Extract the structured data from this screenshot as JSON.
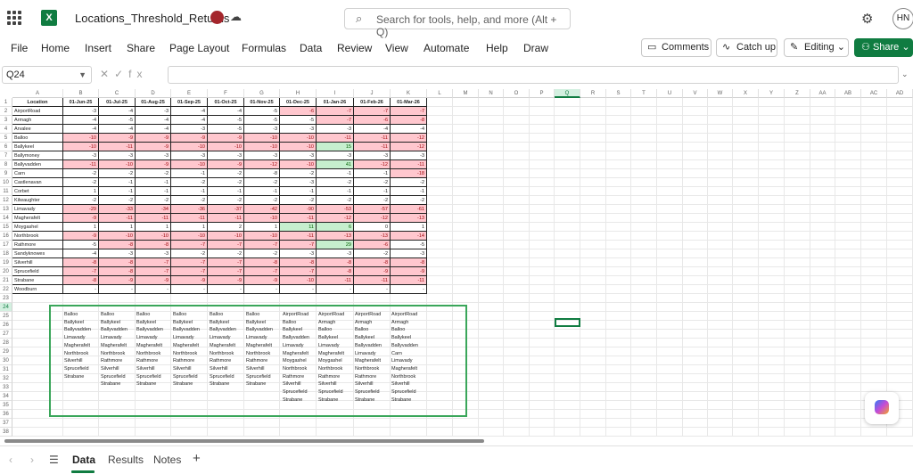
{
  "app": {
    "title": "Locations_Threshold_Returns",
    "logo": "X"
  },
  "search": {
    "placeholder": "Search for tools, help, and more (Alt + Q)"
  },
  "user": {
    "initials": "HN"
  },
  "menu": [
    "File",
    "Home",
    "Insert",
    "Share",
    "Page Layout",
    "Formulas",
    "Data",
    "Review",
    "View",
    "Automate",
    "Help",
    "Draw"
  ],
  "toolbar": {
    "comments": "Comments",
    "catchup": "Catch up",
    "editing": "Editing",
    "share": "Share"
  },
  "namebox": {
    "value": "Q24"
  },
  "columns": [
    "A",
    "B",
    "C",
    "D",
    "E",
    "F",
    "G",
    "H",
    "I",
    "J",
    "K",
    "L",
    "M",
    "N",
    "O",
    "P",
    "Q",
    "R",
    "S",
    "T",
    "U",
    "V",
    "W",
    "X",
    "Y",
    "Z",
    "AA",
    "AB",
    "AC",
    "AD"
  ],
  "selected_column": "Q",
  "selected_row": 24,
  "rows": [
    "1",
    "2",
    "3",
    "4",
    "5",
    "6",
    "7",
    "8",
    "9",
    "10",
    "11",
    "12",
    "13",
    "14",
    "15",
    "16",
    "17",
    "18",
    "19",
    "20",
    "21",
    "22",
    "23",
    "24",
    "25",
    "26",
    "27",
    "28",
    "29",
    "30",
    "31",
    "32",
    "33",
    "34",
    "35",
    "36",
    "37",
    "38"
  ],
  "header": [
    "Location",
    "01-Jun-25",
    "01-Jul-25",
    "01-Aug-25",
    "01-Sep-25",
    "01-Oct-25",
    "01-Nov-25",
    "01-Dec-25",
    "01-Jan-26",
    "01-Feb-26",
    "01-Mar-26"
  ],
  "data": [
    {
      "loc": "AirportRoad",
      "v": [
        "-3",
        "-4",
        "-3",
        "-4",
        "-4",
        "-5",
        "-6",
        "-7",
        "-7",
        "-7"
      ],
      "c": [
        "",
        "",
        "",
        "",
        "",
        "",
        "r",
        "r",
        "r",
        "r"
      ]
    },
    {
      "loc": "Armagh",
      "v": [
        "-4",
        "-5",
        "-4",
        "-4",
        "-5",
        "-5",
        "-5",
        "-7",
        "-6",
        "-8"
      ],
      "c": [
        "",
        "",
        "",
        "",
        "",
        "",
        "",
        "r",
        "r",
        "r"
      ]
    },
    {
      "loc": "Arvalee",
      "v": [
        "-4",
        "-4",
        "-4",
        "-3",
        "-5",
        "-3",
        "-3",
        "-3",
        "-4",
        "-4"
      ],
      "c": [
        "",
        "",
        "",
        "",
        "",
        "",
        "",
        "",
        "",
        ""
      ]
    },
    {
      "loc": "Balloo",
      "v": [
        "-10",
        "-9",
        "-9",
        "-9",
        "-9",
        "-10",
        "-10",
        "-11",
        "-11",
        "-12"
      ],
      "c": [
        "r",
        "r",
        "r",
        "r",
        "r",
        "r",
        "r",
        "r",
        "r",
        "r"
      ]
    },
    {
      "loc": "Ballykeel",
      "v": [
        "-10",
        "-11",
        "-9",
        "-10",
        "-10",
        "-10",
        "-10",
        "15",
        "-11",
        "-12"
      ],
      "c": [
        "r",
        "r",
        "r",
        "r",
        "r",
        "r",
        "r",
        "g",
        "r",
        "r"
      ]
    },
    {
      "loc": "Ballymoney",
      "v": [
        "-3",
        "-3",
        "-3",
        "-3",
        "-3",
        "-3",
        "-3",
        "-3",
        "-3",
        "-3"
      ],
      "c": [
        "",
        "",
        "",
        "",
        "",
        "",
        "",
        "",
        "",
        ""
      ]
    },
    {
      "loc": "Ballyvadden",
      "v": [
        "-11",
        "-10",
        "-9",
        "-10",
        "-9",
        "-12",
        "-10",
        "41",
        "-12",
        "-11"
      ],
      "c": [
        "r",
        "r",
        "r",
        "r",
        "r",
        "r",
        "r",
        "g",
        "r",
        "r"
      ]
    },
    {
      "loc": "Carn",
      "v": [
        "-2",
        "-2",
        "-2",
        "-1",
        "-2",
        "-8",
        "-2",
        "-1",
        "-1",
        "-18"
      ],
      "c": [
        "",
        "",
        "",
        "",
        "",
        "",
        "",
        "",
        "",
        "r"
      ]
    },
    {
      "loc": "Castlenavan",
      "v": [
        "-2",
        "-1",
        "-1",
        "-2",
        "-2",
        "-2",
        "-3",
        "-2",
        "-2",
        "-2"
      ],
      "c": [
        "",
        "",
        "",
        "",
        "",
        "",
        "",
        "",
        "",
        ""
      ]
    },
    {
      "loc": "Corbet",
      "v": [
        "1",
        "-1",
        "-1",
        "-1",
        "-1",
        "-1",
        "-1",
        "-1",
        "-1",
        "-1"
      ],
      "c": [
        "",
        "",
        "",
        "",
        "",
        "",
        "",
        "",
        "",
        ""
      ]
    },
    {
      "loc": "Kilwaughter",
      "v": [
        "-2",
        "-2",
        "-2",
        "-2",
        "-2",
        "-2",
        "-2",
        "-2",
        "-2",
        "-2"
      ],
      "c": [
        "",
        "",
        "",
        "",
        "",
        "",
        "",
        "",
        "",
        ""
      ]
    },
    {
      "loc": "Limavady",
      "v": [
        "-29",
        "-33",
        "-34",
        "-36",
        "-37",
        "-42",
        "-90",
        "-53",
        "-57",
        "-61"
      ],
      "c": [
        "r",
        "r",
        "r",
        "r",
        "r",
        "r",
        "r",
        "r",
        "r",
        "r"
      ]
    },
    {
      "loc": "Magherafelt",
      "v": [
        "-9",
        "-11",
        "-11",
        "-11",
        "-11",
        "-10",
        "-11",
        "-12",
        "-12",
        "-13"
      ],
      "c": [
        "r",
        "r",
        "r",
        "r",
        "r",
        "r",
        "r",
        "r",
        "r",
        "r"
      ]
    },
    {
      "loc": "Moygashel",
      "v": [
        "1",
        "1",
        "1",
        "1",
        "2",
        "1",
        "11",
        "6",
        "0",
        "1"
      ],
      "c": [
        "",
        "",
        "",
        "",
        "",
        "",
        "g",
        "g",
        "",
        ""
      ]
    },
    {
      "loc": "Northbrook",
      "v": [
        "-9",
        "-10",
        "-10",
        "-10",
        "-10",
        "-10",
        "-11",
        "-13",
        "-13",
        "-14"
      ],
      "c": [
        "r",
        "r",
        "r",
        "r",
        "r",
        "r",
        "r",
        "r",
        "r",
        "r"
      ]
    },
    {
      "loc": "Rathmore",
      "v": [
        "-5",
        "-8",
        "-8",
        "-7",
        "-7",
        "-7",
        "-7",
        "29",
        "-6",
        "-5"
      ],
      "c": [
        "",
        "r",
        "r",
        "r",
        "r",
        "r",
        "r",
        "g",
        "r",
        ""
      ]
    },
    {
      "loc": "Sandyknowes",
      "v": [
        "-4",
        "-3",
        "-3",
        "-2",
        "-2",
        "-2",
        "-3",
        "-3",
        "-2",
        "-3"
      ],
      "c": [
        "",
        "",
        "",
        "",
        "",
        "",
        "",
        "",
        "",
        ""
      ]
    },
    {
      "loc": "Silverhill",
      "v": [
        "-8",
        "-8",
        "-7",
        "-7",
        "-7",
        "-8",
        "-8",
        "-8",
        "-8",
        "-8"
      ],
      "c": [
        "r",
        "r",
        "r",
        "r",
        "r",
        "r",
        "r",
        "r",
        "r",
        "r"
      ]
    },
    {
      "loc": "Sprucefield",
      "v": [
        "-7",
        "-8",
        "-7",
        "-7",
        "-7",
        "-7",
        "-7",
        "-8",
        "-9",
        "-9"
      ],
      "c": [
        "r",
        "r",
        "r",
        "r",
        "r",
        "r",
        "r",
        "r",
        "r",
        "r"
      ]
    },
    {
      "loc": "Strabane",
      "v": [
        "-8",
        "-9",
        "-9",
        "-9",
        "-9",
        "-9",
        "-10",
        "-11",
        "-11",
        "-11"
      ],
      "c": [
        "r",
        "r",
        "r",
        "r",
        "r",
        "r",
        "r",
        "r",
        "r",
        "r"
      ]
    },
    {
      "loc": "Woodburn",
      "v": [
        "-",
        "-",
        "-",
        "-",
        "-",
        "-",
        "-",
        "-",
        "-",
        "-"
      ],
      "c": [
        "",
        "",
        "",
        "",
        "",
        "",
        "",
        "",
        "",
        ""
      ]
    }
  ],
  "lists": [
    [
      "Balloo",
      "Ballykeel",
      "Ballyvadden",
      "Limavady",
      "Magherafelt",
      "Northbrook",
      "Silverhill",
      "Sprucefield",
      "Strabane"
    ],
    [
      "Balloo",
      "Ballykeel",
      "Ballyvadden",
      "Limavady",
      "Magherafelt",
      "Northbrook",
      "Rathmore",
      "Silverhill",
      "Sprucefield",
      "Strabane"
    ],
    [
      "Balloo",
      "Ballykeel",
      "Ballyvadden",
      "Limavady",
      "Magherafelt",
      "Northbrook",
      "Rathmore",
      "Silverhill",
      "Sprucefield",
      "Strabane"
    ],
    [
      "Balloo",
      "Ballykeel",
      "Ballyvadden",
      "Limavady",
      "Magherafelt",
      "Northbrook",
      "Rathmore",
      "Silverhill",
      "Sprucefield",
      "Strabane"
    ],
    [
      "Balloo",
      "Ballykeel",
      "Ballyvadden",
      "Limavady",
      "Magherafelt",
      "Northbrook",
      "Rathmore",
      "Silverhill",
      "Sprucefield",
      "Strabane"
    ],
    [
      "Balloo",
      "Ballykeel",
      "Ballyvadden",
      "Limavady",
      "Magherafelt",
      "Northbrook",
      "Rathmore",
      "Silverhill",
      "Sprucefield",
      "Strabane"
    ],
    [
      "AirportRoad",
      "Balloo",
      "Ballykeel",
      "Ballyvadden",
      "Limavady",
      "Magherafelt",
      "Moygashel",
      "Northbrook",
      "Rathmore",
      "Silverhill",
      "Sprucefield",
      "Strabane"
    ],
    [
      "AirportRoad",
      "Armagh",
      "Balloo",
      "Ballykeel",
      "Limavady",
      "Magherafelt",
      "Moygashel",
      "Northbrook",
      "Rathmore",
      "Silverhill",
      "Sprucefield",
      "Strabane"
    ],
    [
      "AirportRoad",
      "Armagh",
      "Balloo",
      "Ballykeel",
      "Ballyvadden",
      "Limavady",
      "Magherafelt",
      "Northbrook",
      "Rathmore",
      "Silverhill",
      "Sprucefield",
      "Strabane"
    ],
    [
      "AirportRoad",
      "Armagh",
      "Balloo",
      "Ballykeel",
      "Ballyvadden",
      "Carn",
      "Limavady",
      "Magherafelt",
      "Northbrook",
      "Silverhill",
      "Sprucefield",
      "Strabane"
    ]
  ],
  "sheets": [
    "Data",
    "Results",
    "Notes"
  ],
  "active_sheet": "Data",
  "colors": {
    "accent": "#107c41",
    "red_fill": "#ffc7ce",
    "red_text": "#9c0006",
    "green_fill": "#c6efce",
    "green_text": "#006100",
    "box": "#3aa65a"
  }
}
